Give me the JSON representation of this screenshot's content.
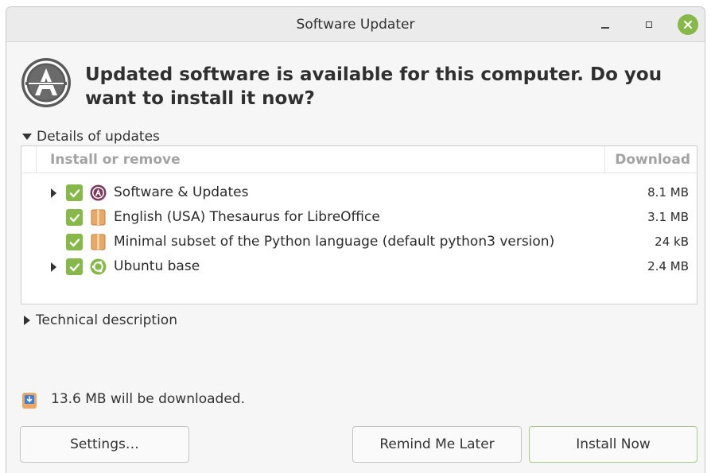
{
  "window": {
    "title": "Software Updater",
    "accent": "#86b94a"
  },
  "header": {
    "message": "Updated software is available for this computer. Do you want to install it now?",
    "icon": "software-updater-icon"
  },
  "details": {
    "label": "Details of updates",
    "expanded": true,
    "columns": {
      "install": "Install or remove",
      "download": "Download"
    },
    "rows": [
      {
        "name": "Software & Updates",
        "size": "8.1 MB",
        "expandable": true,
        "checked": true,
        "icon": "software-properties-icon"
      },
      {
        "name": "English (USA) Thesaurus for LibreOffice",
        "size": "3.1 MB",
        "expandable": false,
        "checked": true,
        "icon": "package-icon"
      },
      {
        "name": "Minimal subset of the Python language (default python3 version)",
        "size": "24 kB",
        "expandable": false,
        "checked": true,
        "icon": "package-icon"
      },
      {
        "name": "Ubuntu base",
        "size": "2.4 MB",
        "expandable": true,
        "checked": true,
        "icon": "ubuntu-logo-icon"
      }
    ]
  },
  "technical": {
    "label": "Technical description",
    "expanded": false
  },
  "status": {
    "download_text": "13.6 MB will be downloaded."
  },
  "buttons": {
    "settings": "Settings…",
    "remind": "Remind Me Later",
    "install": "Install Now"
  }
}
